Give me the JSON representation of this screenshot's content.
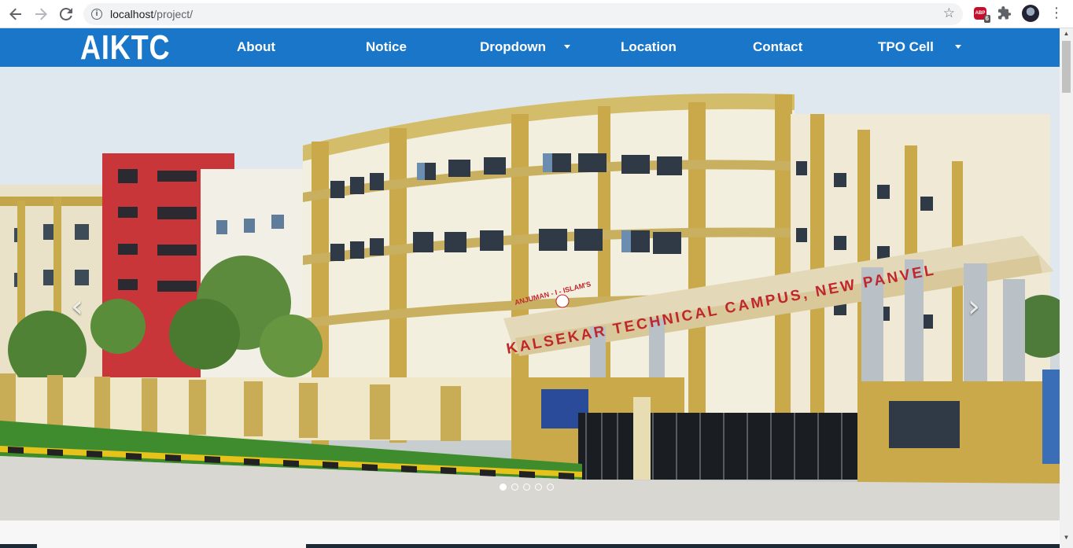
{
  "browser": {
    "url_host": "localhost",
    "url_path": "/project/",
    "ext_badge": "6",
    "ext_abp_label": "ABP",
    "icons": [
      "back-icon",
      "forward-icon",
      "reload-icon",
      "info-icon",
      "bookmark-star-icon",
      "adblock-icon",
      "puzzle-icon",
      "profile-avatar",
      "kebab-menu-icon"
    ]
  },
  "nav": {
    "brand": "AIKTC",
    "items": [
      {
        "label": "About"
      },
      {
        "label": "Notice"
      },
      {
        "label": "Dropdown",
        "has_caret": true
      },
      {
        "label": "Location"
      },
      {
        "label": "Contact"
      },
      {
        "label": "TPO Cell",
        "has_caret": true
      }
    ],
    "bg_color": "#1976c8"
  },
  "carousel": {
    "sign_text": "KALSEKAR TECHNICAL CAMPUS, NEW PANVEL",
    "sign_text_small": "ANJUMAN - I - ISLAM'S",
    "slide_count": 5,
    "active_index": 0,
    "prev_glyph": "‹",
    "next_glyph": "›"
  }
}
